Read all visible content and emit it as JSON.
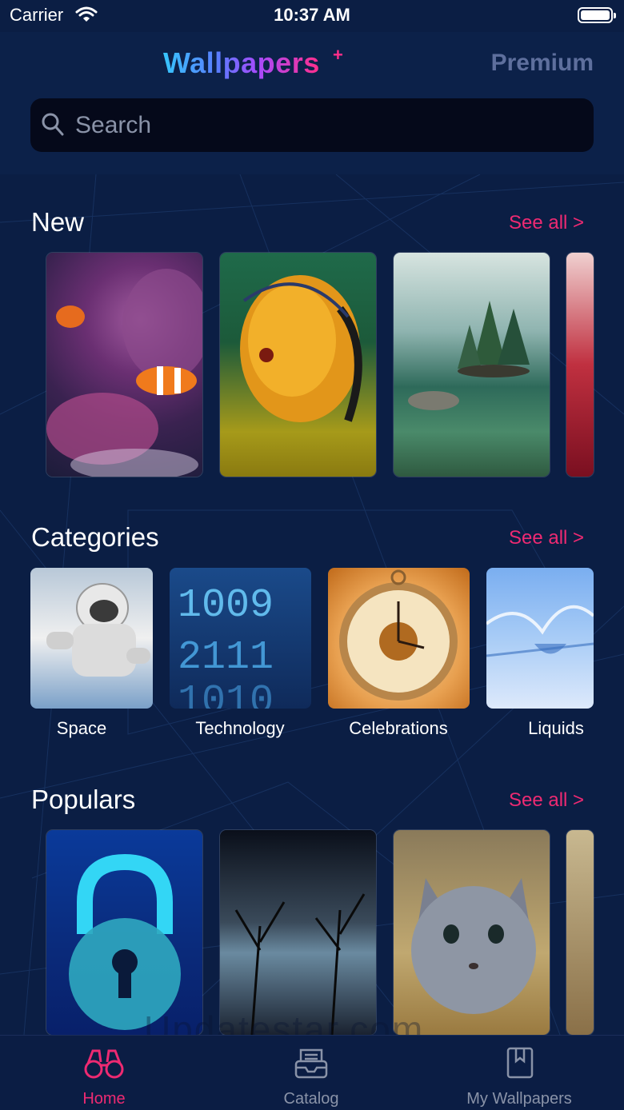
{
  "status_bar": {
    "carrier": "Carrier",
    "time": "10:37 AM"
  },
  "header": {
    "logo": "Wallpapers",
    "logo_plus": "+",
    "premium": "Premium"
  },
  "search": {
    "placeholder": "Search"
  },
  "sections": {
    "new": {
      "title": "New",
      "see_all": "See all >"
    },
    "categories": {
      "title": "Categories",
      "see_all": "See all >",
      "items": [
        {
          "label": "Space"
        },
        {
          "label": "Technology"
        },
        {
          "label": "Celebrations"
        },
        {
          "label": "Liquids"
        }
      ]
    },
    "populars": {
      "title": "Populars",
      "see_all": "See all >"
    }
  },
  "tabs": [
    {
      "label": "Home",
      "icon": "binoculars-icon",
      "active": true
    },
    {
      "label": "Catalog",
      "icon": "inbox-tray-icon",
      "active": false
    },
    {
      "label": "My Wallpapers",
      "icon": "bookmark-book-icon",
      "active": false
    }
  ],
  "watermark": "Updatestar.com",
  "colors": {
    "accent": "#ee2a72",
    "background": "#0b1e44",
    "premium": "#5e6f9d"
  }
}
